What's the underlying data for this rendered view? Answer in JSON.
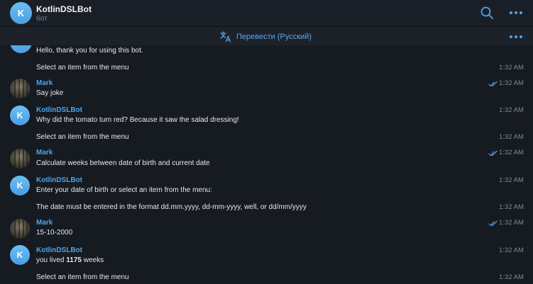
{
  "header": {
    "avatar_letter": "K",
    "name": "KotlinDSLBot",
    "status": "бот",
    "search_icon": "search-icon",
    "more_icon": "more-horizontal-icon"
  },
  "translate": {
    "label": "Перевести (Русский)",
    "icon": "translate-icon"
  },
  "colors": {
    "accent": "#4ea4ec",
    "background": "#161a21",
    "header": "#1a1f27"
  },
  "messages": [
    {
      "sender": "",
      "text": "Hello, thank you for using this bot.",
      "time": ""
    },
    {
      "sender": "",
      "text": "Select an item from the menu",
      "time": "1:32 AM"
    },
    {
      "sender": "Mark",
      "text": "Say joke",
      "time": "1:32 AM",
      "read": true
    },
    {
      "sender": "KotlinDSLBot",
      "avatar_letter": "K",
      "text": "Why did the tomato turn red? Because it saw the salad dressing!",
      "time": "1:32 AM"
    },
    {
      "sender": "",
      "text": "Select an item from the menu",
      "time": "1:32 AM"
    },
    {
      "sender": "Mark",
      "text": "Calculate weeks between date of birth and current date",
      "time": "1:32 AM",
      "read": true
    },
    {
      "sender": "KotlinDSLBot",
      "avatar_letter": "K",
      "text": "Enter your date of birth or select an item from the menu:",
      "time": "1:32 AM"
    },
    {
      "sender": "",
      "text": "The date must be entered in the format dd.mm.yyyy, dd-mm-yyyy, well, or dd/mm/yyyy",
      "time": "1:32 AM"
    },
    {
      "sender": "Mark",
      "text": "15-10-2000",
      "time": "1:32 AM",
      "read": true
    },
    {
      "sender": "KotlinDSLBot",
      "avatar_letter": "K",
      "text_prefix": "you lived ",
      "text_bold": "1175",
      "text_suffix": " weeks",
      "time": "1:32 AM"
    },
    {
      "sender": "",
      "text": "Select an item from the menu",
      "time": "1:32 AM"
    }
  ]
}
